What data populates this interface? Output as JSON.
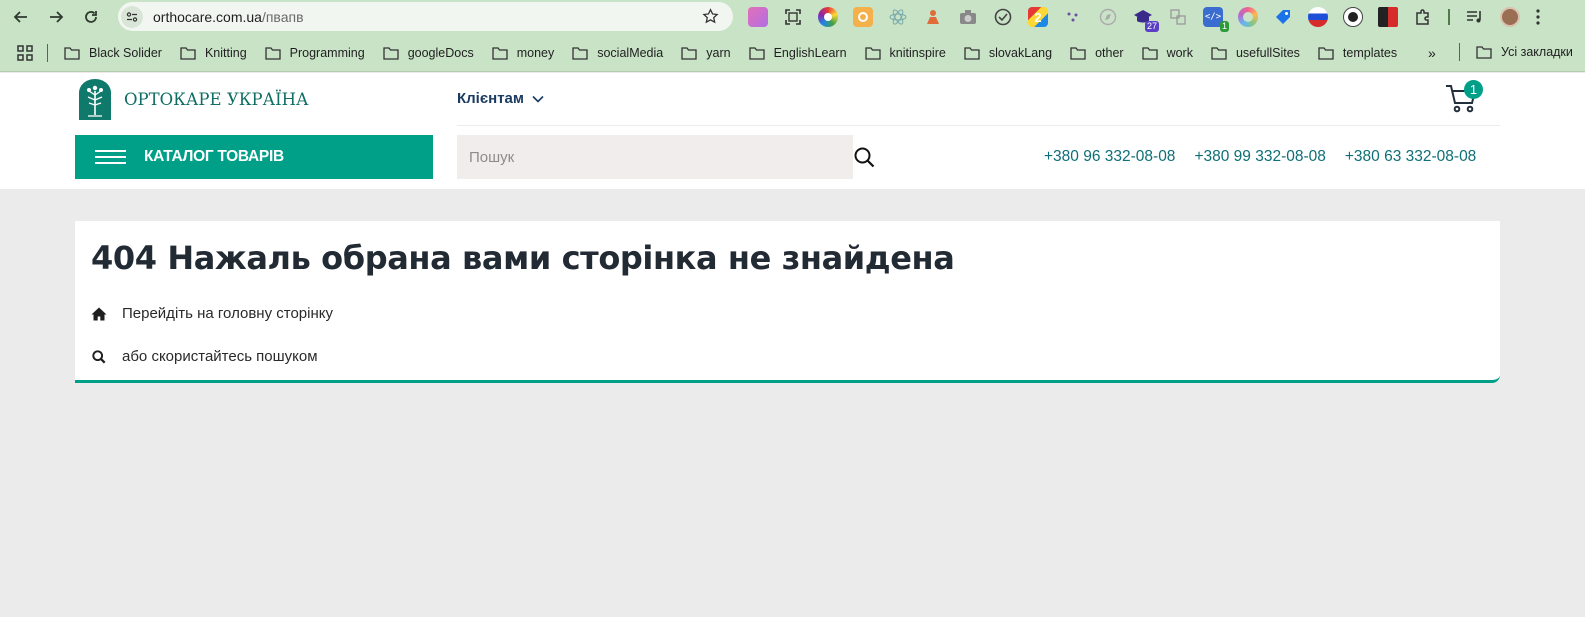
{
  "browser": {
    "url_host": "orthocare.com.ua",
    "url_path": "/пвапв",
    "extension_badges": {
      "ext_13": "27",
      "ext_15": "1"
    },
    "bookmarks": [
      "Black Solider",
      "Knitting",
      "Programming",
      "googleDocs",
      "money",
      "socialMedia",
      "yarn",
      "EnglishLearn",
      "knitinspire",
      "slovakLang",
      "other",
      "work",
      "usefullSites",
      "templates"
    ],
    "bookmarks_more": "»",
    "all_bookmarks": "Усі закладки"
  },
  "header": {
    "logo_text": "ОРТОКАРЕ УКРАЇНА",
    "clients_menu": "Клієнтам",
    "cart_count": "1",
    "catalog_label": "КАТАЛОГ ТОВАРІВ",
    "search_placeholder": "Пошук",
    "phones": [
      "+380 96 332-08-08",
      "+380 99 332-08-08",
      "+380 63 332-08-08"
    ]
  },
  "error_page": {
    "title": "404 Нажаль обрана вами сторінка не знайдена",
    "home_link": "Перейдіть на головну сторінку",
    "search_hint": "або скористайтесь пошуком"
  },
  "colors": {
    "brand_green": "#00a088",
    "brand_dark_teal": "#0f6d63",
    "phone_color": "#0d6f76",
    "browser_chrome": "#c9e3c7",
    "page_bg": "#ebebeb"
  }
}
